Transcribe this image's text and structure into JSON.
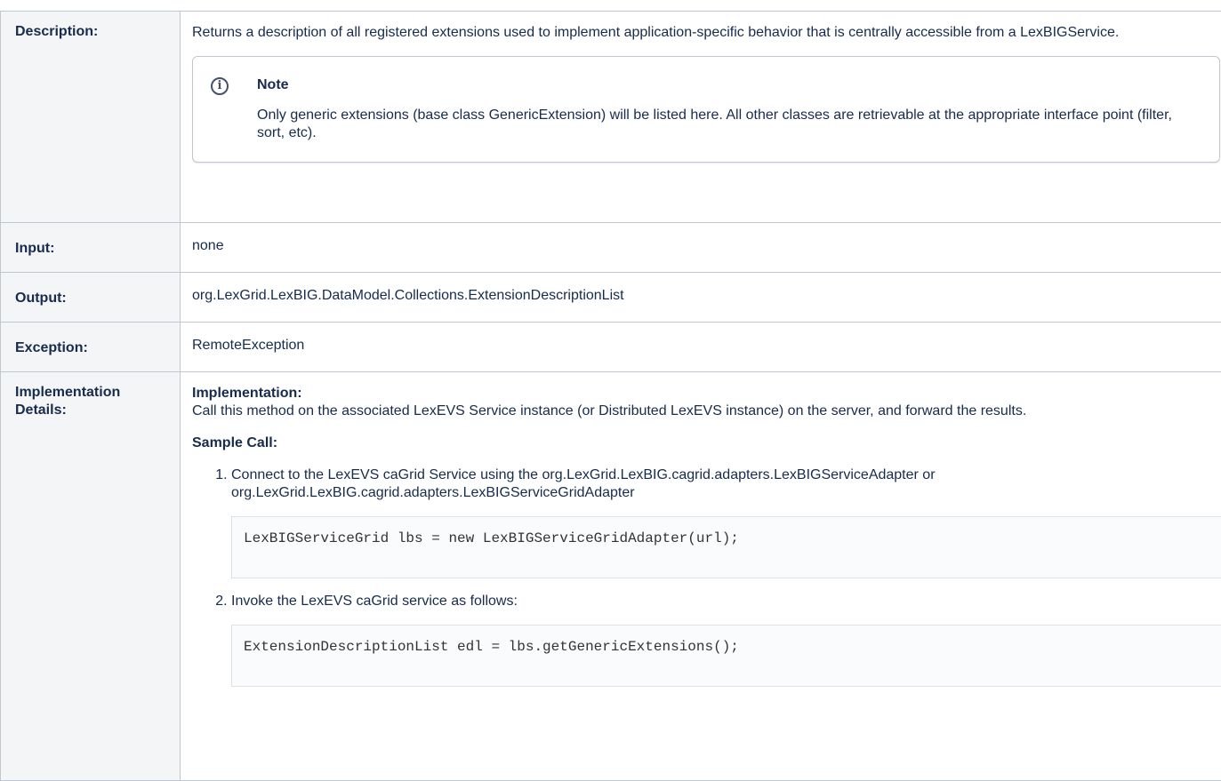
{
  "rows": {
    "description": {
      "label": "Description:",
      "text": "Returns a description of all registered extensions used to implement application-specific behavior that is centrally accessible from a LexBIGService.",
      "note": {
        "icon": "info-icon",
        "title": "Note",
        "body": "Only generic extensions (base class GenericExtension) will be listed here. All other classes are retrievable at the appropriate interface point (filter, sort, etc)."
      }
    },
    "input": {
      "label": "Input:",
      "value": "none"
    },
    "output": {
      "label": "Output:",
      "value": "org.LexGrid.LexBIG.DataModel.Collections.ExtensionDescriptionList"
    },
    "exception": {
      "label": "Exception:",
      "value": "RemoteException"
    },
    "implementation": {
      "label": "Implementation Details:",
      "heading": "Implementation:",
      "text": "Call this method on the associated LexEVS Service instance (or Distributed LexEVS instance) on the server, and forward the results.",
      "sample_heading": "Sample Call:",
      "steps": [
        {
          "text": "Connect to the LexEVS caGrid Service using the org.LexGrid.LexBIG.cagrid.adapters.LexBIGServiceAdapter or org.LexGrid.LexBIG.cagrid.adapters.LexBIGServiceGridAdapter",
          "code": "LexBIGServiceGrid lbs = new LexBIGServiceGridAdapter(url);"
        },
        {
          "text": "Invoke the LexEVS caGrid service as follows:",
          "code": "ExtensionDescriptionList edl = lbs.getGenericExtensions();"
        }
      ]
    }
  }
}
